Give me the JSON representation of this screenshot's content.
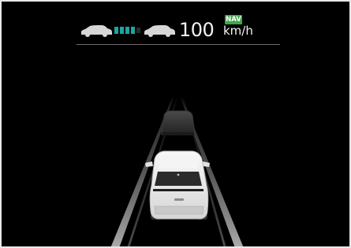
{
  "cluster": {
    "set_speed": "100",
    "speed_unit": "km/h",
    "nav_badge": "NAV",
    "icons": {
      "lead_vehicle": "car-silhouette-icon",
      "distance": "following-distance-bars-icon",
      "own_vehicle": "car-silhouette-icon"
    },
    "colors": {
      "nav_badge": "#3da74a",
      "distance_bars": "#19a7a0",
      "text": "#f2f2f2",
      "background": "#000000"
    },
    "following_distance_level": 4
  }
}
